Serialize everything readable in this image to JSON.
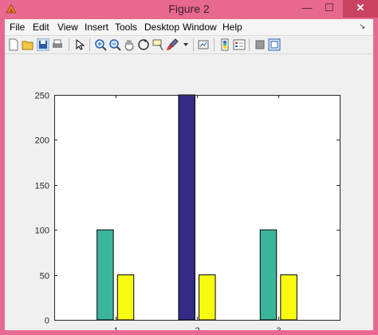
{
  "window": {
    "title": "Figure 2",
    "min_label": "—",
    "max_label": "☐",
    "close_label": "✕"
  },
  "menu": {
    "items": [
      "File",
      "Edit",
      "View",
      "Insert",
      "Tools",
      "Desktop",
      "Window",
      "Help"
    ],
    "overflow": "↘"
  },
  "toolbar": {
    "icons": [
      "new-figure-icon",
      "open-file-icon",
      "save-icon",
      "print-icon",
      "edit-plot-icon",
      "zoom-in-icon",
      "zoom-out-icon",
      "pan-icon",
      "rotate-3d-icon",
      "data-cursor-icon",
      "brush-icon",
      "brush-dropdown-icon",
      "link-plot-icon",
      "insert-colorbar-icon",
      "insert-legend-icon",
      "hide-plot-tools-icon",
      "show-plot-tools-icon"
    ]
  },
  "colors": {
    "teal": "#3bb59b",
    "navy": "#352a87",
    "yellow": "#f9fb0e"
  },
  "chart_data": {
    "type": "bar",
    "categories": [
      "1",
      "2",
      "3"
    ],
    "series": [
      {
        "values": [
          100,
          250,
          100
        ],
        "color": "#3bb59b"
      },
      {
        "values": [
          50,
          50,
          50
        ],
        "color": "#f9fb0e"
      }
    ],
    "bar_colors": [
      [
        "#3bb59b",
        "#352a87",
        "#3bb59b"
      ],
      [
        "#f9fb0e",
        "#f9fb0e",
        "#f9fb0e"
      ]
    ],
    "yticks": [
      0,
      50,
      100,
      150,
      200,
      250
    ],
    "ylim": [
      0,
      250
    ],
    "xlim": [
      0.25,
      3.75
    ],
    "title": "",
    "xlabel": "",
    "ylabel": ""
  }
}
